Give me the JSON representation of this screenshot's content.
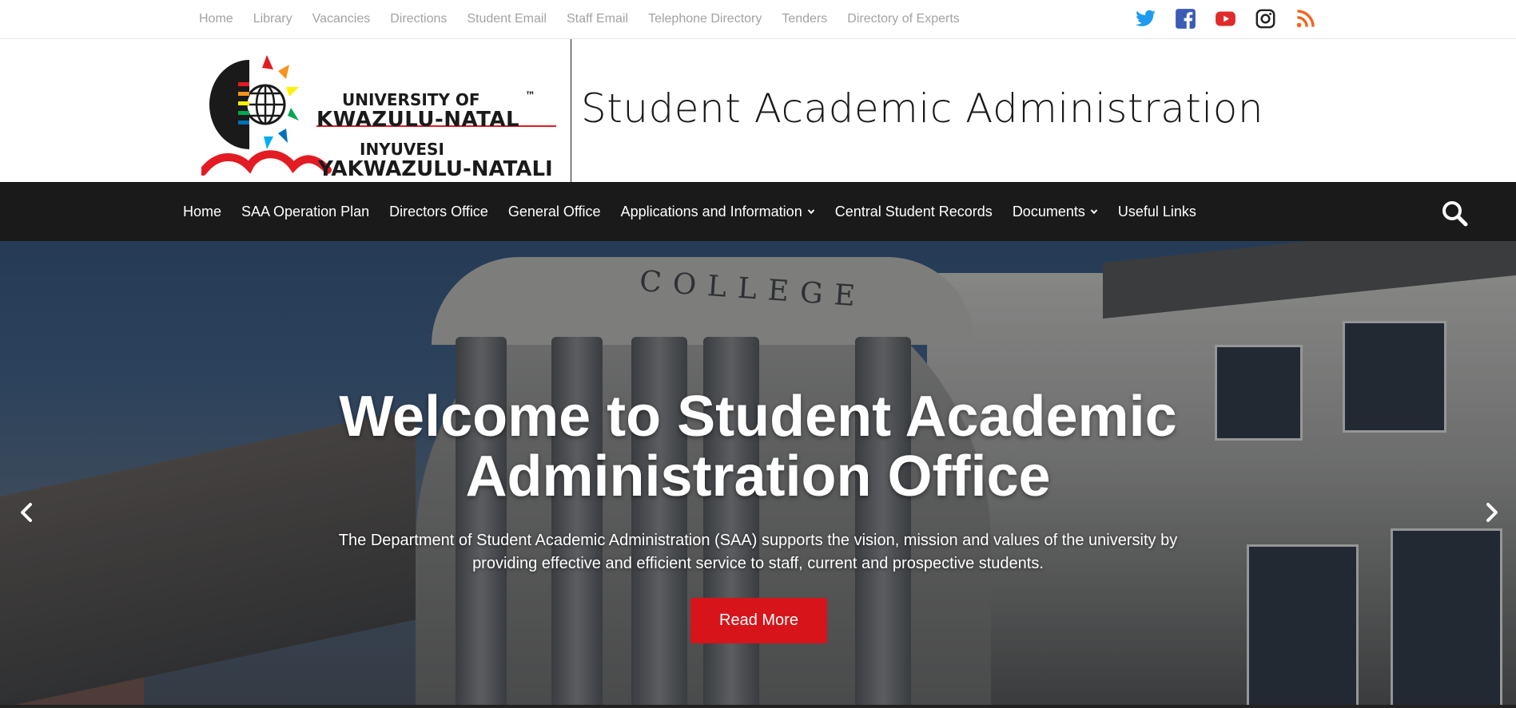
{
  "top_links": [
    "Home",
    "Library",
    "Vacancies",
    "Directions",
    "Student Email",
    "Staff Email",
    "Telephone Directory",
    "Tenders",
    "Directory of Experts"
  ],
  "social_icons": [
    {
      "name": "twitter-icon",
      "color": "#1d9bf0"
    },
    {
      "name": "facebook-icon",
      "color": "#3b5bb5"
    },
    {
      "name": "youtube-icon",
      "color": "#e02b2b"
    },
    {
      "name": "instagram-icon",
      "color": "#222222"
    },
    {
      "name": "rss-icon",
      "color": "#f26522"
    }
  ],
  "logo": {
    "line1": "UNIVERSITY OF",
    "line2": "KWAZULU-NATAL",
    "line3": "INYUVESI",
    "line4": "YAKWAZULU-NATALI",
    "tm": "™"
  },
  "site_title": "Student Academic Administration",
  "nav": {
    "items": [
      {
        "label": "Home",
        "dropdown": false
      },
      {
        "label": "SAA Operation Plan",
        "dropdown": false
      },
      {
        "label": "Directors Office",
        "dropdown": false
      },
      {
        "label": "General Office",
        "dropdown": false
      },
      {
        "label": "Applications and Information",
        "dropdown": true
      },
      {
        "label": "Central Student Records",
        "dropdown": false
      },
      {
        "label": "Documents",
        "dropdown": true
      },
      {
        "label": "Useful Links",
        "dropdown": false
      }
    ]
  },
  "hero": {
    "title_line1": "Welcome to Student Academic",
    "title_line2": "Administration Office",
    "text_line1": "The Department of Student Academic Administration (SAA) supports the vision, mission and values of the university by",
    "text_line2": "providing effective and efficient service to staff, current and prospective students.",
    "button_label": "Read More",
    "building_text": "COLLEGE"
  },
  "colors": {
    "nav_bg": "#1a1a1a",
    "accent_red": "#d7141a",
    "toplink": "#a3a3a3"
  }
}
